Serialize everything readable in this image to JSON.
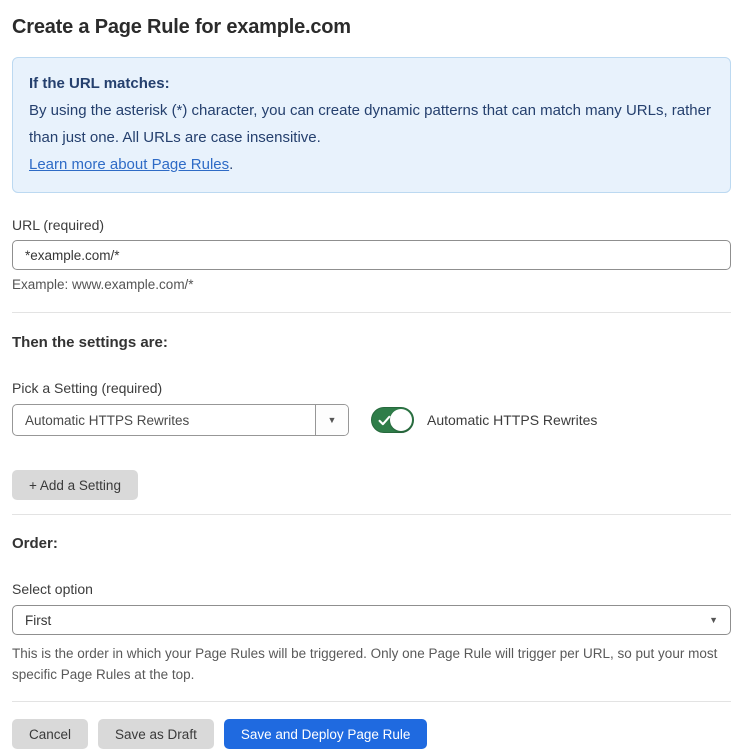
{
  "page": {
    "title": "Create a Page Rule for example.com"
  },
  "info_box": {
    "heading": "If the URL matches:",
    "body": "By using the asterisk (*) character, you can create dynamic patterns that can match many URLs, rather than just one. All URLs are case insensitive.",
    "link_label": "Learn more about Page Rules",
    "link_suffix": "."
  },
  "url_field": {
    "label": "URL (required)",
    "value": "*example.com/*",
    "helper": "Example: www.example.com/*"
  },
  "settings_section": {
    "heading": "Then the settings are:",
    "picker_label": "Pick a Setting (required)",
    "selected_setting": "Automatic HTTPS Rewrites",
    "dropdown_arrow": "▼",
    "toggle": {
      "state": "on",
      "label": "Automatic HTTPS Rewrites"
    },
    "add_setting_label": "+ Add a Setting"
  },
  "order_section": {
    "heading": "Order:",
    "select_label": "Select option",
    "selected_option": "First",
    "select_arrow": "▼",
    "helper": "This is the order in which your Page Rules will be triggered. Only one Page Rule will trigger per URL, so put your most specific Page Rules at the top."
  },
  "footer": {
    "cancel_label": "Cancel",
    "save_draft_label": "Save as Draft",
    "save_deploy_label": "Save and Deploy Page Rule"
  },
  "colors": {
    "primary_button_blue": "#1f6ae0",
    "toggle_green": "#2f7d49",
    "info_box_background": "#e8f2fc",
    "info_box_border": "#bcd9f1",
    "info_box_text": "#25406e",
    "link_blue": "#2e6bc6",
    "secondary_button_gray": "#d9d9d9"
  }
}
